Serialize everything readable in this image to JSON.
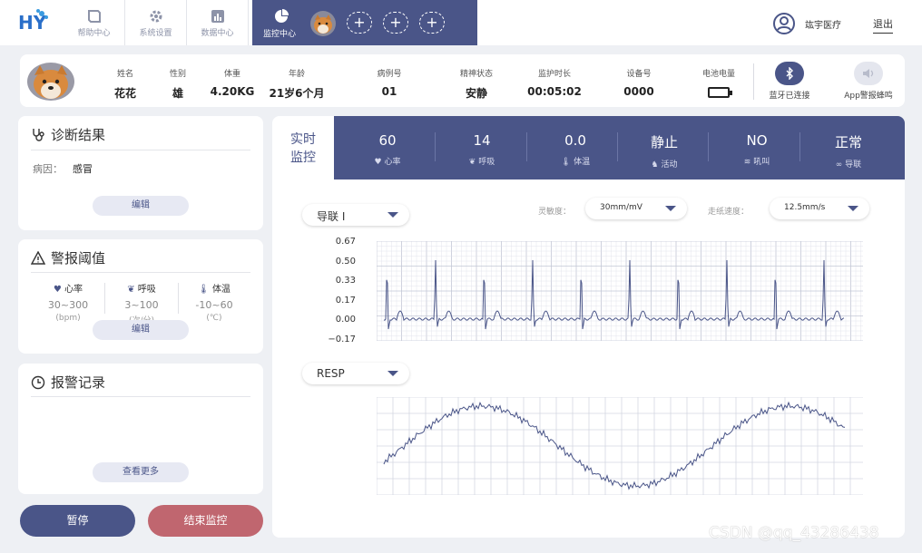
{
  "nav": {
    "items": [
      {
        "label": "帮助中心",
        "icon": "book-icon"
      },
      {
        "label": "系统设置",
        "icon": "gear-icon"
      },
      {
        "label": "数据中心",
        "icon": "bar-chart-icon"
      }
    ],
    "active": {
      "label": "监控中心",
      "icon": "pie-chart-icon"
    },
    "org_name": "竑宇医疗",
    "logout_label": "退出"
  },
  "patient": {
    "fields": [
      {
        "label": "姓名",
        "value": "花花"
      },
      {
        "label": "性别",
        "value": "雄"
      },
      {
        "label": "体重",
        "value": "4.20KG"
      },
      {
        "label": "年龄",
        "value": "21岁6个月"
      },
      {
        "label": "病例号",
        "value": "01"
      },
      {
        "label": "精神状态",
        "value": "安静"
      },
      {
        "label": "监护时长",
        "value": "00:05:02"
      },
      {
        "label": "设备号",
        "value": "0000"
      }
    ],
    "battery_label": "电池电量",
    "bluetooth_label": "蓝牙已连接",
    "app_alarm_label": "App警报蜂鸣"
  },
  "diagnosis": {
    "title": "诊断结果",
    "cause_label": "病因：",
    "cause_value": "感冒",
    "edit_label": "编辑"
  },
  "thresholds": {
    "title": "警报阈值",
    "items": [
      {
        "name": "心率",
        "range": "30~300",
        "unit": "(bpm)",
        "icon": "heart-icon"
      },
      {
        "name": "呼吸",
        "range": "3~100",
        "unit": "(次/分)",
        "icon": "lungs-icon"
      },
      {
        "name": "体温",
        "range": "-10~60",
        "unit": "(℃)",
        "icon": "thermometer-icon"
      }
    ],
    "edit_label": "编辑"
  },
  "alarm_log": {
    "title": "报警记录",
    "more_label": "查看更多"
  },
  "actions": {
    "pause_label": "暂停",
    "stop_label": "结束监控"
  },
  "monitor": {
    "realtime_label_1": "实时",
    "realtime_label_2": "监控",
    "vitals": [
      {
        "value": "60",
        "label": "心率",
        "icon": "heart-icon"
      },
      {
        "value": "14",
        "label": "呼吸",
        "icon": "lungs-icon"
      },
      {
        "value": "0.0",
        "label": "体温",
        "icon": "thermometer-icon"
      },
      {
        "value": "静止",
        "label": "活动",
        "icon": "activity-icon"
      },
      {
        "value": "NO",
        "label": "吼叫",
        "icon": "sound-icon"
      },
      {
        "value": "正常",
        "label": "导联",
        "icon": "link-icon"
      }
    ],
    "lead_select": "导联 I",
    "sensitivity_label": "灵敏度：",
    "sensitivity_value": "30mm/mV",
    "speed_label": "走纸速度：",
    "speed_value": "12.5mm/s",
    "resp_select": "RESP"
  },
  "chart_data": [
    {
      "type": "line",
      "title": "",
      "series": [
        {
          "values": []
        }
      ],
      "ylim": [
        -0.17,
        0.67
      ],
      "yticks": [
        "0.67",
        "0.50",
        "0.33",
        "0.17",
        "0.00",
        "−0.17"
      ],
      "grid": true
    },
    {
      "type": "line",
      "title": "",
      "series": [
        {
          "values": []
        }
      ],
      "grid": true
    }
  ],
  "watermark": "CSDN @qq_43286438",
  "colors": {
    "primary": "#4a5588",
    "danger": "#c0666f",
    "grid": "#c9cbd6"
  }
}
